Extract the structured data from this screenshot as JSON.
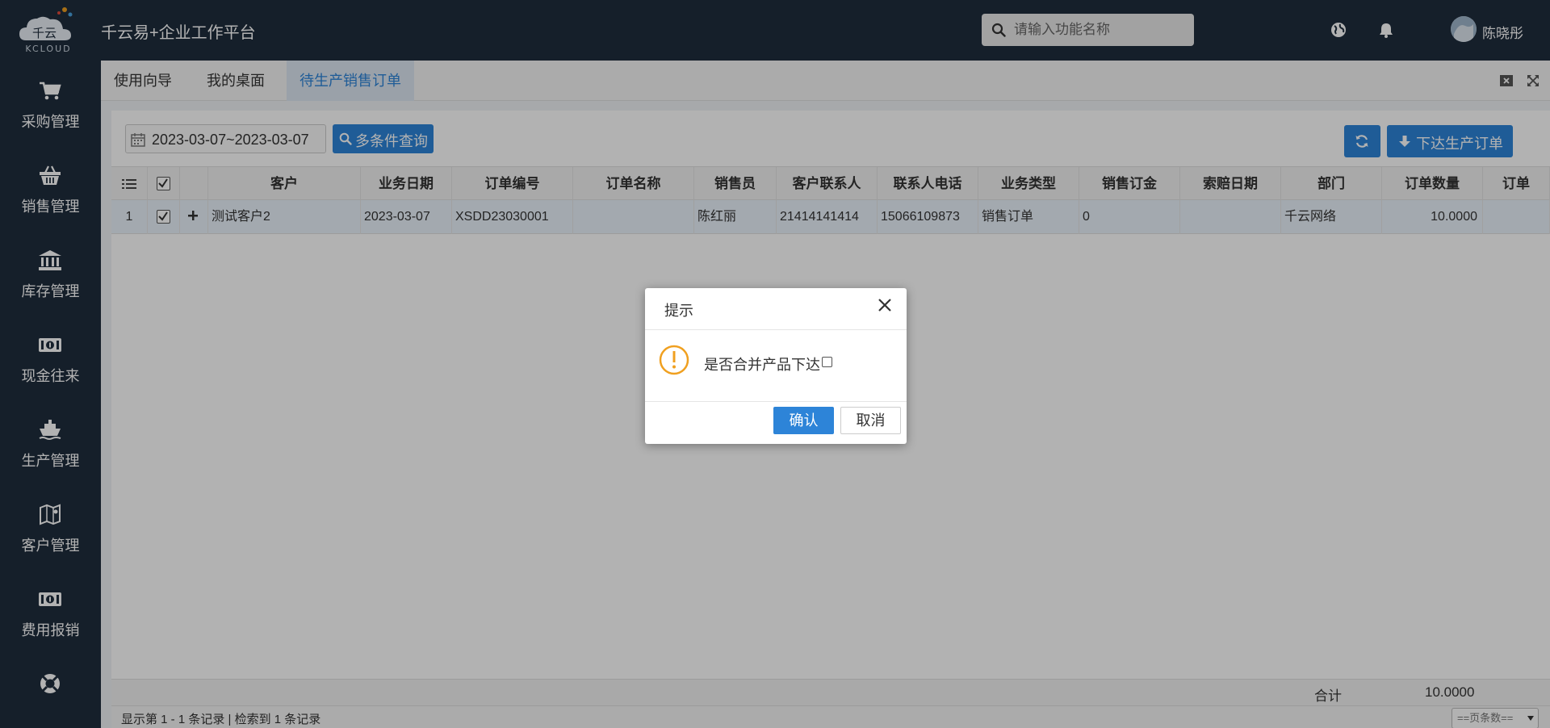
{
  "header": {
    "logo_text": "千云",
    "logo_subtext": "KCLOUD",
    "app_title": "千云易+企业工作平台",
    "search_placeholder": "请输入功能名称",
    "user_name": "陈晓彤"
  },
  "sidebar": {
    "items": [
      {
        "label": "采购管理",
        "icon": "cart-icon"
      },
      {
        "label": "销售管理",
        "icon": "basket-icon"
      },
      {
        "label": "库存管理",
        "icon": "bank-icon"
      },
      {
        "label": "现金往来",
        "icon": "money-icon"
      },
      {
        "label": "生产管理",
        "icon": "ship-icon"
      },
      {
        "label": "客户管理",
        "icon": "map-icon"
      },
      {
        "label": "费用报销",
        "icon": "money-icon"
      },
      {
        "label": "",
        "icon": "lifebuoy-icon"
      }
    ]
  },
  "tabs": [
    {
      "label": "使用向导",
      "active": false
    },
    {
      "label": "我的桌面",
      "active": false
    },
    {
      "label": "待生产销售订单",
      "active": true
    }
  ],
  "toolbar": {
    "date_range": "2023-03-07~2023-03-07",
    "multi_query_label": "多条件查询",
    "release_label": "下达生产订单"
  },
  "table": {
    "columns": [
      "客户",
      "业务日期",
      "订单编号",
      "订单名称",
      "销售员",
      "客户联系人",
      "联系人电话",
      "业务类型",
      "销售订金",
      "索赔日期",
      "部门",
      "订单数量",
      "订单"
    ],
    "rows": [
      {
        "index": "1",
        "checked": true,
        "cells": [
          "测试客户2",
          "2023-03-07",
          "XSDD23030001",
          "",
          "陈红丽",
          "21414141414",
          "15066109873",
          "销售订单",
          "0",
          "",
          "千云网络",
          "10.0000",
          ""
        ]
      }
    ],
    "footer": {
      "sum_label": "合计",
      "sum_value": "10.0000"
    }
  },
  "pager": {
    "info": "显示第 1 - 1 条记录 | 检索到 1 条记录",
    "page_size_label": "==页条数=="
  },
  "dialog": {
    "title": "提示",
    "message": "是否合并产品下达",
    "confirm_label": "确认",
    "cancel_label": "取消"
  },
  "colors": {
    "nav_bg": "#1f2d3d",
    "accent": "#2d84d8",
    "warning": "#f0a020"
  }
}
